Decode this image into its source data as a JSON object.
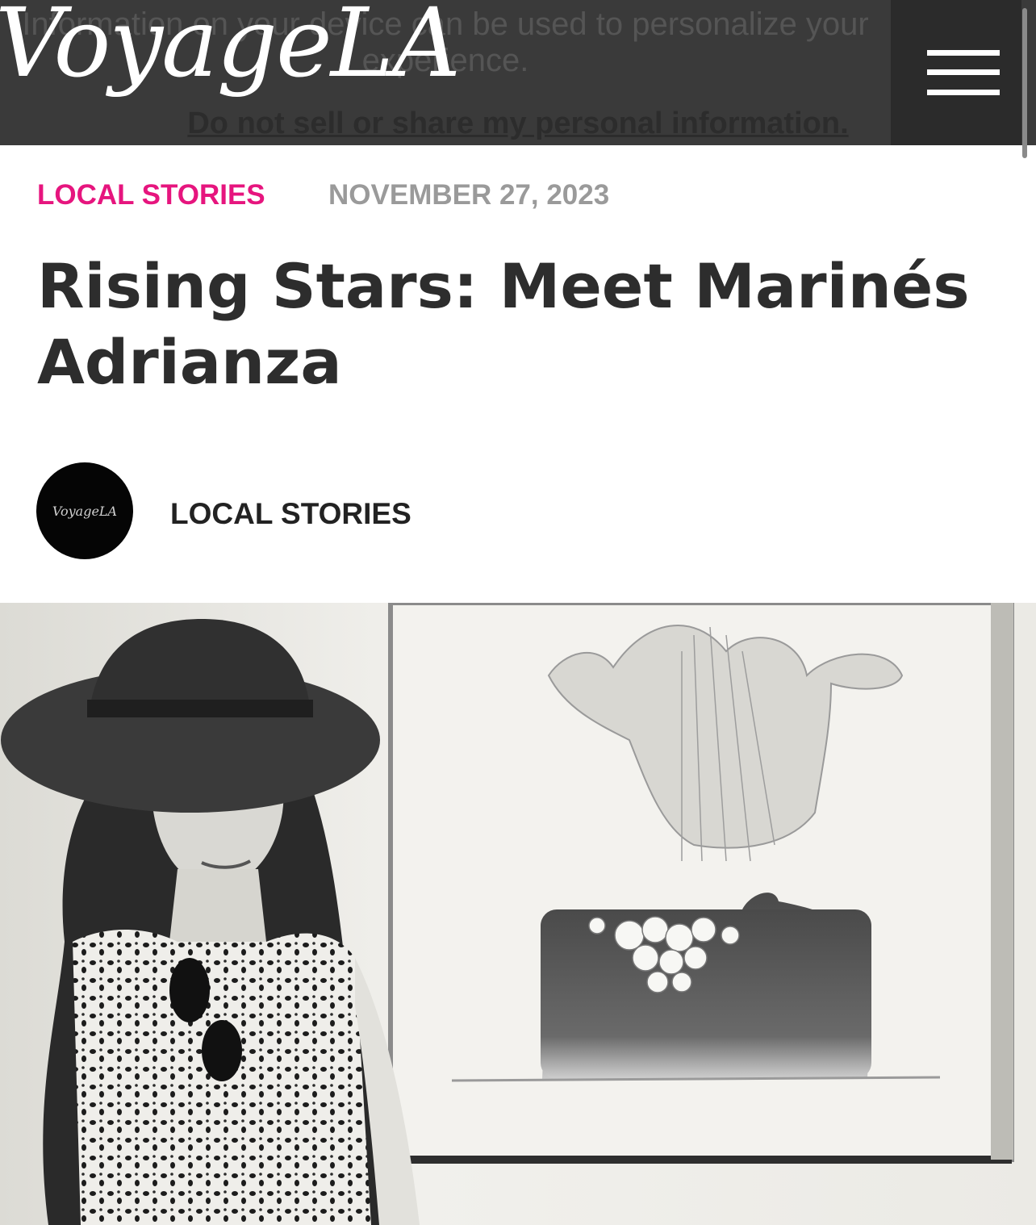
{
  "header": {
    "logo": "VoyageLA",
    "consent_line1": "Information on your device can be used to personalize your",
    "consent_line2": "experience.",
    "consent_link": "Do not sell or share my personal information."
  },
  "article": {
    "category": "LOCAL STORIES",
    "date": "NOVEMBER 27, 2023",
    "title": "Rising Stars: Meet Marinés Adrianza",
    "author_avatar_text": "VoyageLA",
    "author": "LOCAL STORIES"
  },
  "icons": {
    "menu": "hamburger-menu-icon"
  }
}
